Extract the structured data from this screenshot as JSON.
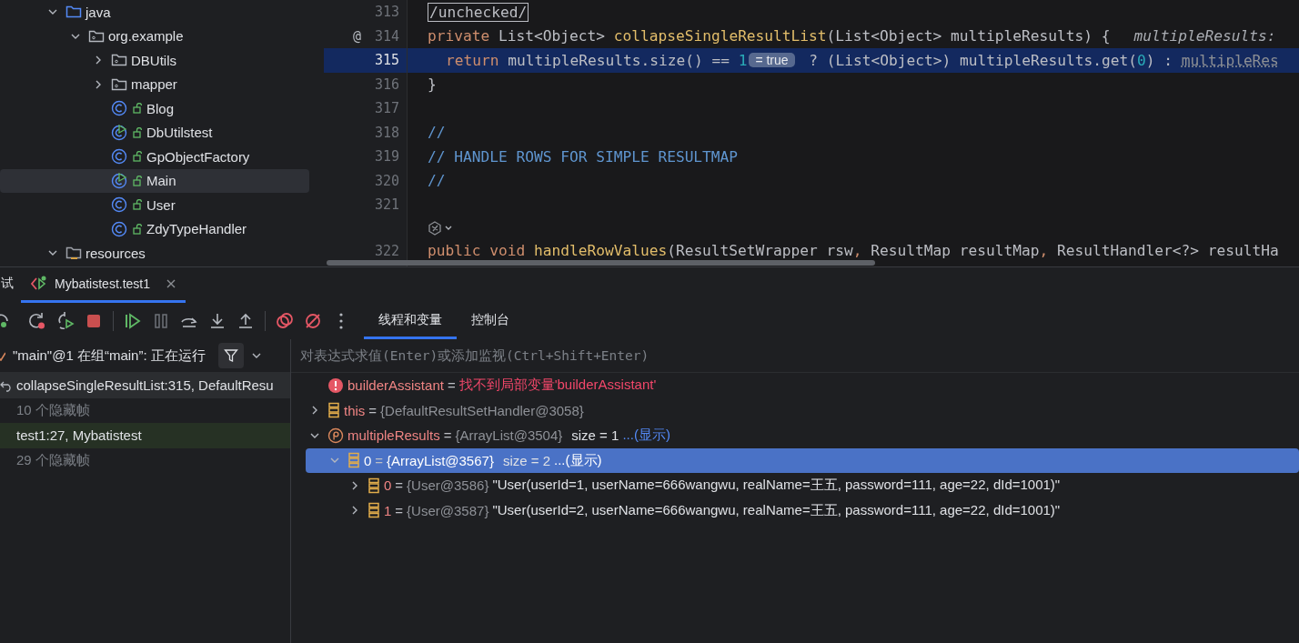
{
  "project_tree": [
    {
      "kind": "source-folder",
      "label": "java",
      "expanded": true,
      "selected": false,
      "children": [
        {
          "kind": "package",
          "label": "org.example",
          "expanded": true,
          "selected": false,
          "children": [
            {
              "kind": "package",
              "label": "DBUtils",
              "expanded": false,
              "selected": false
            },
            {
              "kind": "package",
              "label": "mapper",
              "expanded": false,
              "selected": false
            },
            {
              "kind": "class",
              "label": "Blog",
              "runnable": false,
              "selected": false
            },
            {
              "kind": "class",
              "label": "DbUtilstest",
              "runnable": true,
              "selected": false
            },
            {
              "kind": "class",
              "label": "GpObjectFactory",
              "runnable": false,
              "selected": false
            },
            {
              "kind": "class",
              "label": "Main",
              "runnable": true,
              "selected": true
            },
            {
              "kind": "class",
              "label": "User",
              "runnable": false,
              "selected": false
            },
            {
              "kind": "class",
              "label": "ZdyTypeHandler",
              "runnable": false,
              "selected": false
            }
          ]
        }
      ]
    },
    {
      "kind": "resource-folder",
      "label": "resources",
      "expanded": true,
      "selected": false
    }
  ],
  "editor": {
    "lines": [
      {
        "kind": "line",
        "number": "313",
        "current": false,
        "tokens": [
          {
            "kind": "boxed",
            "text": "/unchecked/"
          }
        ]
      },
      {
        "kind": "line",
        "number": "314",
        "current": false,
        "marker": "@",
        "tokens": [
          {
            "kind": "keyword",
            "text": "private"
          },
          {
            "kind": "plain",
            "text": " List<Object> "
          },
          {
            "kind": "method",
            "text": "collapseSingleResultList"
          },
          {
            "kind": "plain",
            "text": "(List<Object> multipleResults) {"
          },
          {
            "kind": "hint",
            "text": "multipleResults:"
          }
        ]
      },
      {
        "kind": "line",
        "number": "315",
        "current": true,
        "indented": true,
        "tokens": [
          {
            "kind": "keyword",
            "text": "return"
          },
          {
            "kind": "plain",
            "text": " multipleResults.size() == "
          },
          {
            "kind": "number",
            "text": "1"
          },
          {
            "kind": "badge",
            "text": "= true"
          },
          {
            "kind": "plain",
            "text": " ? (List<Object>) multipleResults.get("
          },
          {
            "kind": "number",
            "text": "0"
          },
          {
            "kind": "plain",
            "text": ") : "
          },
          {
            "kind": "warn",
            "text": "multipleRes"
          }
        ]
      },
      {
        "kind": "line",
        "number": "316",
        "current": false,
        "tokens": [
          {
            "kind": "plain",
            "text": "}"
          }
        ]
      },
      {
        "kind": "line",
        "number": "317",
        "current": false
      },
      {
        "kind": "line",
        "number": "318",
        "current": false,
        "tokens": [
          {
            "kind": "comment",
            "text": "//"
          }
        ]
      },
      {
        "kind": "line",
        "number": "319",
        "current": false,
        "tokens": [
          {
            "kind": "comment",
            "text": "// HANDLE ROWS FOR SIMPLE RESULTMAP"
          }
        ]
      },
      {
        "kind": "line",
        "number": "320",
        "current": false,
        "tokens": [
          {
            "kind": "comment",
            "text": "//"
          }
        ]
      },
      {
        "kind": "line",
        "number": "321",
        "current": false
      },
      {
        "kind": "lens"
      },
      {
        "kind": "line",
        "number": "322",
        "current": false,
        "tokens": [
          {
            "kind": "keyword",
            "text": "public void "
          },
          {
            "kind": "method",
            "text": "handleRowValues"
          },
          {
            "kind": "plain",
            "text": "(ResultSetWrapper rsw"
          },
          {
            "kind": "keyword",
            "text": ", "
          },
          {
            "kind": "plain",
            "text": "ResultMap resultMap"
          },
          {
            "kind": "keyword",
            "text": ", "
          },
          {
            "kind": "plain",
            "text": "ResultHandler<?> resultHa"
          }
        ]
      }
    ]
  },
  "debug_tabs": [
    {
      "kind": "tool",
      "label": "试",
      "selected": false
    },
    {
      "kind": "session",
      "label": "Mybatistest.test1",
      "selected": true
    }
  ],
  "sub_tabs": [
    {
      "label": "线程和变量",
      "selected": true
    },
    {
      "label": "控制台",
      "selected": false
    }
  ],
  "thread": {
    "label": "\"main\"@1 在组“main”: 正在运行"
  },
  "frames": [
    {
      "kind": "current",
      "label": "collapseSingleResultList:315, DefaultResu",
      "selected": true
    },
    {
      "kind": "hidden",
      "label": "10 个隐藏帧",
      "selected": false
    },
    {
      "kind": "own",
      "label": "test1:27, Mybatistest",
      "selected": false
    },
    {
      "kind": "hidden",
      "label": "29 个隐藏帧",
      "selected": false
    }
  ],
  "evaluate": {
    "placeholder": "对表达式求值(Enter)或添加监视(Ctrl+Shift+Enter)"
  },
  "variables": [
    {
      "kind": "error",
      "name": "builderAssistant",
      "sign": "=",
      "value": "找不到局部变量'builderAssistant'",
      "selected": false
    },
    {
      "kind": "field",
      "name": "this",
      "sign": "=",
      "ref": "{DefaultResultSetHandler@3058}",
      "expanded": false,
      "selected": false
    },
    {
      "kind": "param",
      "name": "multipleResults",
      "sign": "=",
      "ref": "{ArrayList@3504}",
      "size": "size = 1",
      "link": "...(显示)",
      "expanded": true,
      "selected": false,
      "children": [
        {
          "kind": "field",
          "name": "0",
          "sign": "=",
          "ref": "{ArrayList@3567}",
          "size": "size = 2",
          "link": "...(显示)",
          "expanded": true,
          "selected": true,
          "children": [
            {
              "kind": "field",
              "name": "0",
              "sign": "=",
              "ref": "{User@3586}",
              "detail": "\"User(userId=1, userName=666wangwu, realName=王五, password=111, age=22, dId=1001)\"",
              "expanded": false,
              "selected": false
            },
            {
              "kind": "field",
              "name": "1",
              "sign": "=",
              "ref": "{User@3587}",
              "detail": "\"User(userId=2, userName=666wangwu, realName=王五, password=111, age=22, dId=1001)\"",
              "expanded": false,
              "selected": false
            }
          ]
        }
      ]
    }
  ]
}
